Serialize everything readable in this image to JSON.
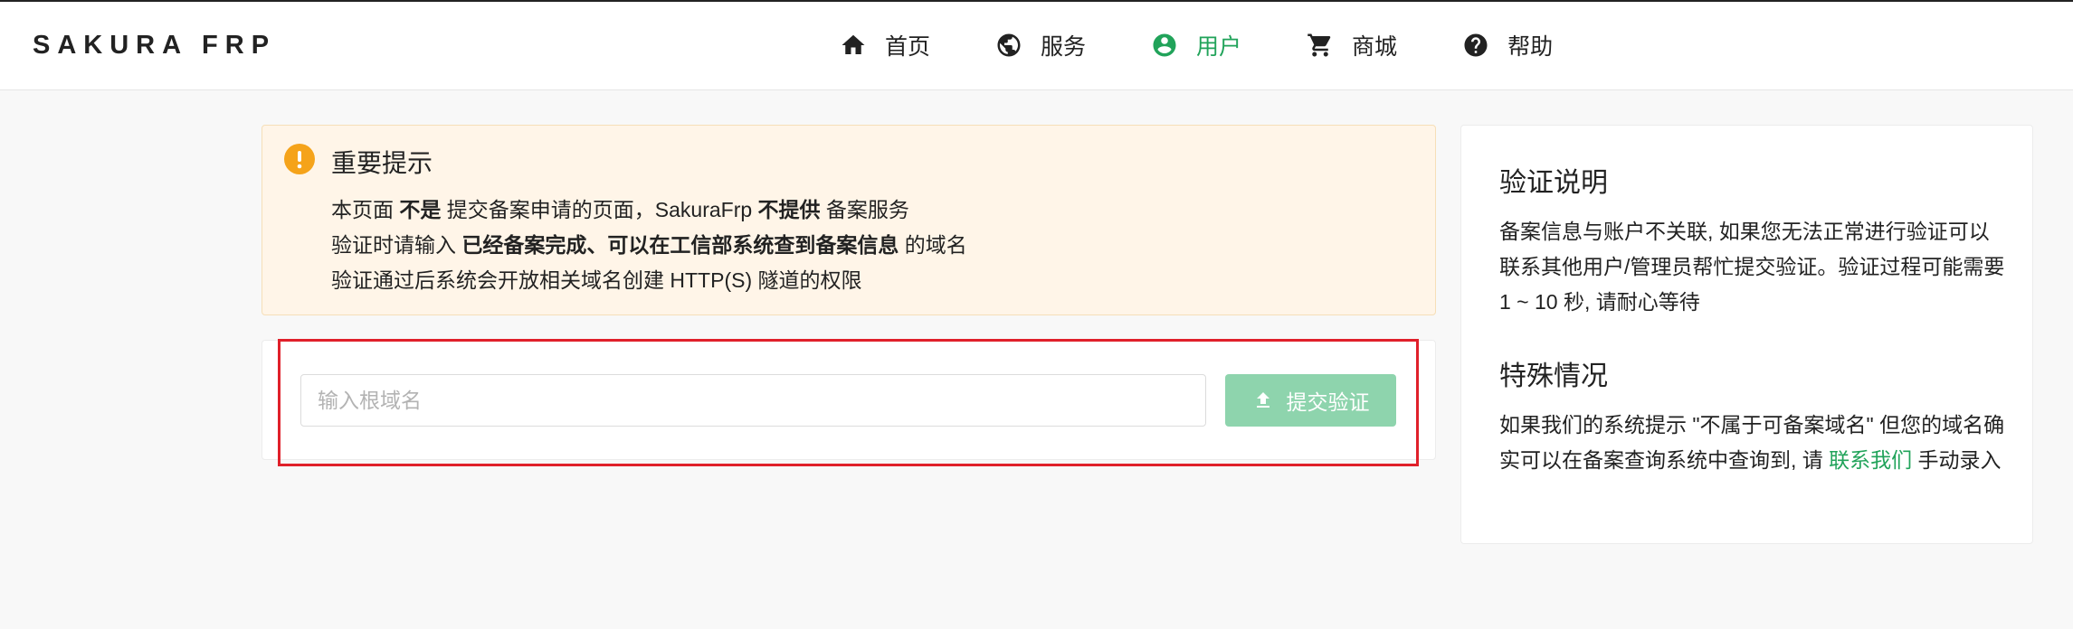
{
  "brand": "SAKURA FRP",
  "nav": [
    {
      "label": "首页",
      "icon": "home-icon"
    },
    {
      "label": "服务",
      "icon": "globe-icon"
    },
    {
      "label": "用户",
      "icon": "user-circle-icon",
      "active": true
    },
    {
      "label": "商城",
      "icon": "cart-icon"
    },
    {
      "label": "帮助",
      "icon": "help-icon"
    }
  ],
  "notice": {
    "title": "重要提示",
    "line1": {
      "a": "本页面 ",
      "b": "不是",
      "c": " 提交备案申请的页面，SakuraFrp ",
      "d": "不提供",
      "e": " 备案服务"
    },
    "line2": {
      "a": "验证时请输入 ",
      "b": "已经备案完成、可以在工信部系统查到备案信息",
      "c": " 的域名"
    },
    "line3": "验证通过后系统会开放相关域名创建 HTTP(S) 隧道的权限"
  },
  "form": {
    "placeholder": "输入根域名",
    "value": "",
    "submit_label": "提交验证"
  },
  "side": {
    "h1": "验证说明",
    "p1": "备案信息与账户不关联, 如果您无法正常进行验证可以联系其他用户/管理员帮忙提交验证。验证过程可能需要 1 ~ 10 秒, 请耐心等待",
    "h2": "特殊情况",
    "p2_pre": "如果我们的系统提示 \"不属于可备案域名\" 但您的域名确实可以在备案查询系统中查询到, 请 ",
    "p2_link": "联系我们",
    "p2_post": " 手动录入"
  },
  "colors": {
    "accent": "#21a35a",
    "button": "#8ed4ad",
    "warning": "#f5a31a",
    "notice_bg": "#fff5e8",
    "highlight": "#e0202a"
  }
}
